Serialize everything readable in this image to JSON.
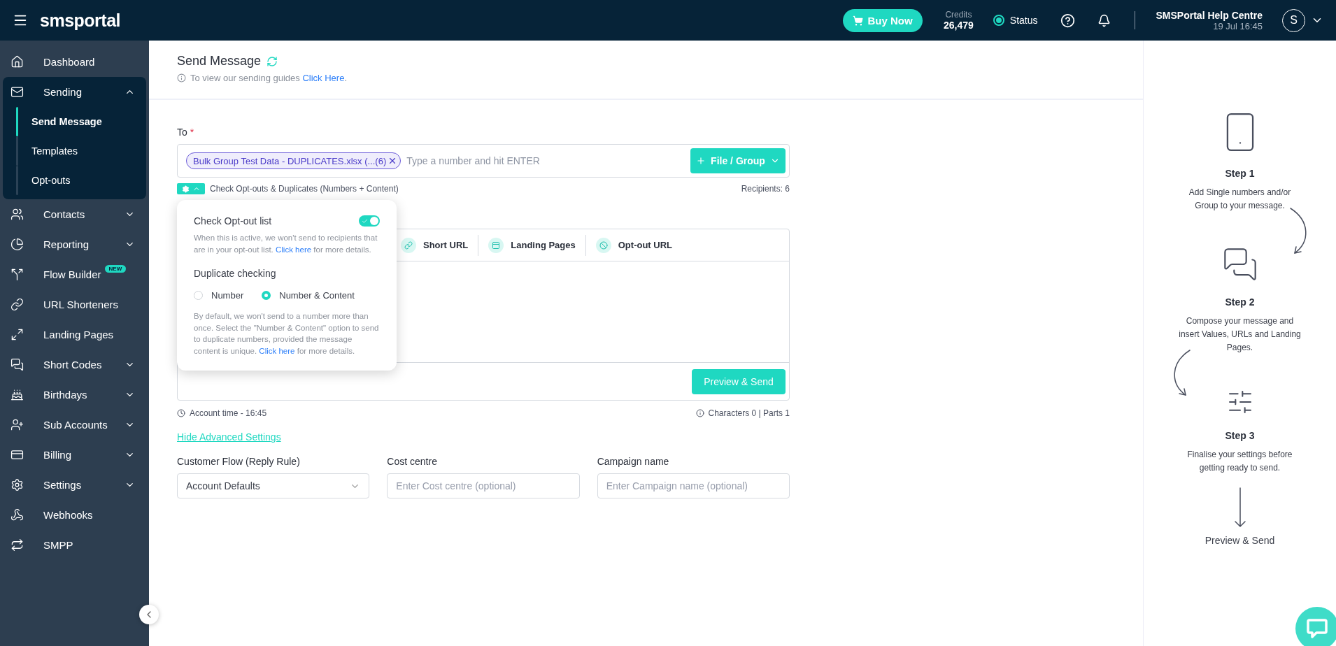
{
  "header": {
    "brand": "smsportal",
    "buy_button": "Buy Now",
    "credits_label": "Credits",
    "credits_value": "26,479",
    "status_label": "Status",
    "status_ok": true,
    "help_centre": "SMSPortal Help Centre",
    "datetime": "19 Jul 16:45",
    "avatar_initial": "S"
  },
  "sidebar": {
    "items": [
      {
        "label": "Dashboard",
        "kind": "link",
        "selected": false
      },
      {
        "label": "Sending",
        "kind": "group",
        "expanded": true,
        "selected": false,
        "children": [
          {
            "label": "Send Message",
            "selected": true
          },
          {
            "label": "Templates",
            "selected": false
          },
          {
            "label": "Opt-outs",
            "selected": false
          }
        ]
      },
      {
        "label": "Contacts",
        "kind": "group",
        "expanded": false,
        "selected": false
      },
      {
        "label": "Reporting",
        "kind": "group",
        "expanded": false,
        "selected": false
      },
      {
        "label": "Flow Builder",
        "kind": "link",
        "selected": false,
        "badge": "NEW"
      },
      {
        "label": "URL Shorteners",
        "kind": "link",
        "selected": false
      },
      {
        "label": "Landing Pages",
        "kind": "link",
        "selected": false
      },
      {
        "label": "Short Codes",
        "kind": "group",
        "expanded": false,
        "selected": false
      },
      {
        "label": "Birthdays",
        "kind": "group",
        "expanded": false,
        "selected": false
      },
      {
        "label": "Sub Accounts",
        "kind": "group",
        "expanded": false,
        "selected": false
      },
      {
        "label": "Billing",
        "kind": "group",
        "expanded": false,
        "selected": false
      },
      {
        "label": "Settings",
        "kind": "group",
        "expanded": false,
        "selected": false
      },
      {
        "label": "Webhooks",
        "kind": "link",
        "selected": false
      },
      {
        "label": "SMPP",
        "kind": "link",
        "selected": false
      }
    ]
  },
  "page": {
    "title": "Send Message",
    "guide_text": "To view our sending guides",
    "guide_link": "Click Here",
    "guide_end": "."
  },
  "to": {
    "label": "To",
    "required_mark": "*",
    "chips": [
      {
        "label": "Bulk Group Test Data - DUPLICATES.xlsx (...(6)"
      }
    ],
    "placeholder": "Type a number and hit ENTER",
    "file_button": "File / Group"
  },
  "checks": {
    "summary": "Check Opt-outs & Duplicates (Numbers + Content)",
    "recipients": "Recipients: 6",
    "expanded": true
  },
  "popover": {
    "optout_title": "Check Opt-out list",
    "optout_on": true,
    "optout_text": "When this is active, we won't send to recipients that are in your opt-out list.",
    "optout_link": "Click here",
    "optout_end": "for more details.",
    "duplicate_title": "Duplicate checking",
    "options": [
      {
        "label": "Number",
        "selected": false
      },
      {
        "label": "Number & Content",
        "selected": true
      }
    ],
    "duplicate_text": "By default, we won't send to a number more than once. Select the \"Number & Content\" option to send to duplicate numbers, provided the message content is unique.",
    "duplicate_link": "Click here",
    "duplicate_end": "for more details."
  },
  "composer": {
    "tools": [
      {
        "label": "Short URL"
      },
      {
        "label": "Landing Pages"
      },
      {
        "label": "Opt-out URL"
      }
    ],
    "preview_button": "Preview & Send"
  },
  "account_time": "Account time - 16:45",
  "characters": "Characters 0 | Parts 1",
  "advanced_link": "Hide Advanced Settings",
  "fields": [
    {
      "label": "Customer Flow (Reply Rule)",
      "kind": "select",
      "value": "Account Defaults"
    },
    {
      "label": "Cost centre",
      "kind": "input",
      "placeholder": "Enter Cost centre (optional)"
    },
    {
      "label": "Campaign name",
      "kind": "input",
      "placeholder": "Enter Campaign name (optional)"
    }
  ],
  "steps": [
    {
      "title": "Step 1",
      "text": "Add Single numbers and/or Group to your message."
    },
    {
      "title": "Step 2",
      "text": "Compose your message and insert Values, URLs and Landing Pages."
    },
    {
      "title": "Step 3",
      "text": "Finalise your settings before getting ready to send."
    }
  ],
  "final_step": "Preview & Send"
}
